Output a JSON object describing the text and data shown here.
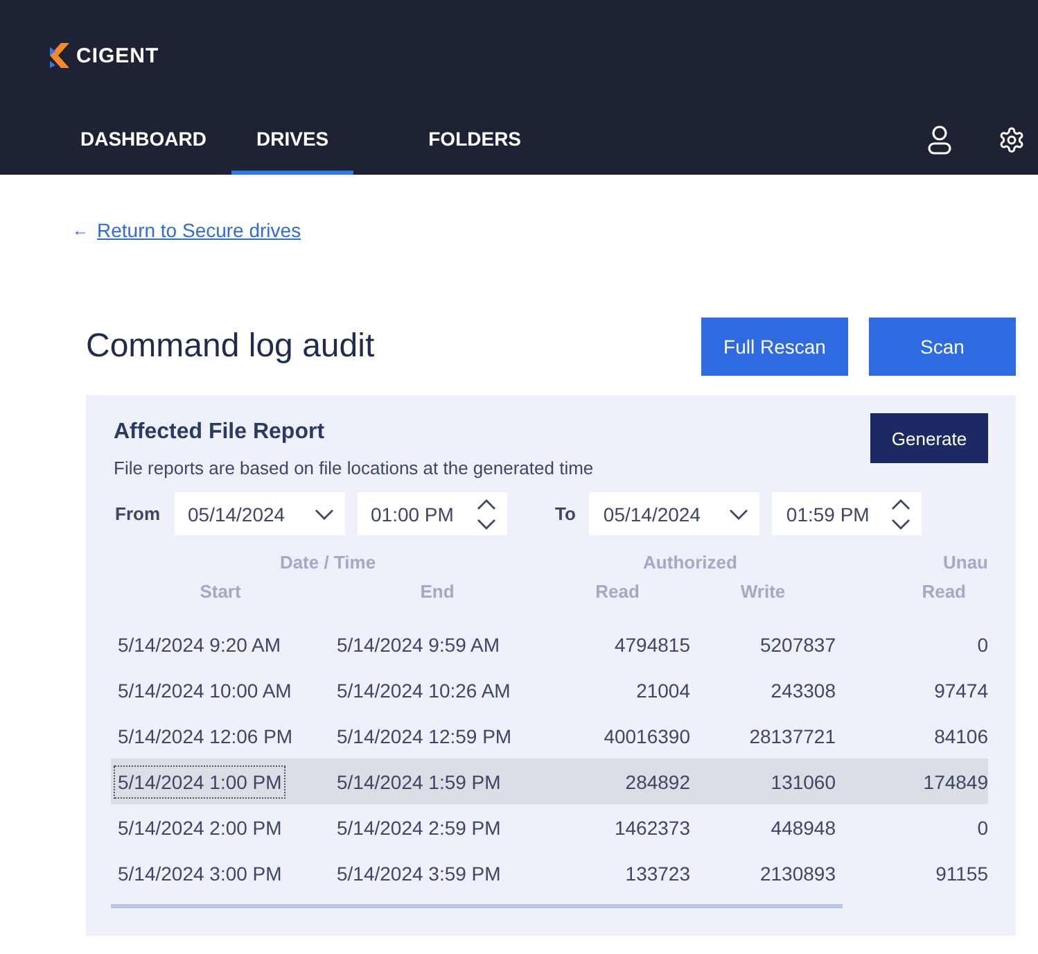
{
  "header": {
    "logo": "CIGENT",
    "nav": [
      {
        "label": "DASHBOARD",
        "selected": false
      },
      {
        "label": "DRIVES",
        "selected": true
      },
      {
        "label": "FOLDERS",
        "selected": false
      }
    ]
  },
  "back_link": {
    "arrow": "←",
    "label": "Return to Secure drives"
  },
  "title": "Command log audit",
  "actions": [
    "Full Rescan",
    "Scan"
  ],
  "report": {
    "title": "Affected File Report",
    "note": "File reports are based on file locations at the generated time",
    "generate": "Generate",
    "from": {
      "label": "From",
      "date": "05/14/2024",
      "time": "01:00 PM"
    },
    "to": {
      "label": "To",
      "date": "05/14/2024",
      "time": "01:59 PM"
    },
    "table": {
      "groups": [
        "Date / Time",
        "Authorized",
        "Unau"
      ],
      "columns": [
        "Start",
        "End",
        "Read",
        "Write",
        "Read"
      ],
      "rows": [
        {
          "cells": [
            "5/14/2024 9:20 AM",
            "5/14/2024 9:59 AM",
            "4794815",
            "5207837",
            "0"
          ],
          "selected": false
        },
        {
          "cells": [
            "5/14/2024 10:00 AM",
            "5/14/2024 10:26 AM",
            "21004",
            "243308",
            "97474"
          ],
          "selected": false
        },
        {
          "cells": [
            "5/14/2024 12:06 PM",
            "5/14/2024 12:59 PM",
            "40016390",
            "28137721",
            "84106"
          ],
          "selected": false
        },
        {
          "cells": [
            "5/14/2024 1:00 PM",
            "5/14/2024 1:59 PM",
            "284892",
            "131060",
            "174849"
          ],
          "selected": true
        },
        {
          "cells": [
            "5/14/2024 2:00 PM",
            "5/14/2024 2:59 PM",
            "1462373",
            "448948",
            "0"
          ],
          "selected": false
        },
        {
          "cells": [
            "5/14/2024 3:00 PM",
            "5/14/2024 3:59 PM",
            "133723",
            "2130893",
            "91155"
          ],
          "selected": false
        }
      ]
    }
  }
}
